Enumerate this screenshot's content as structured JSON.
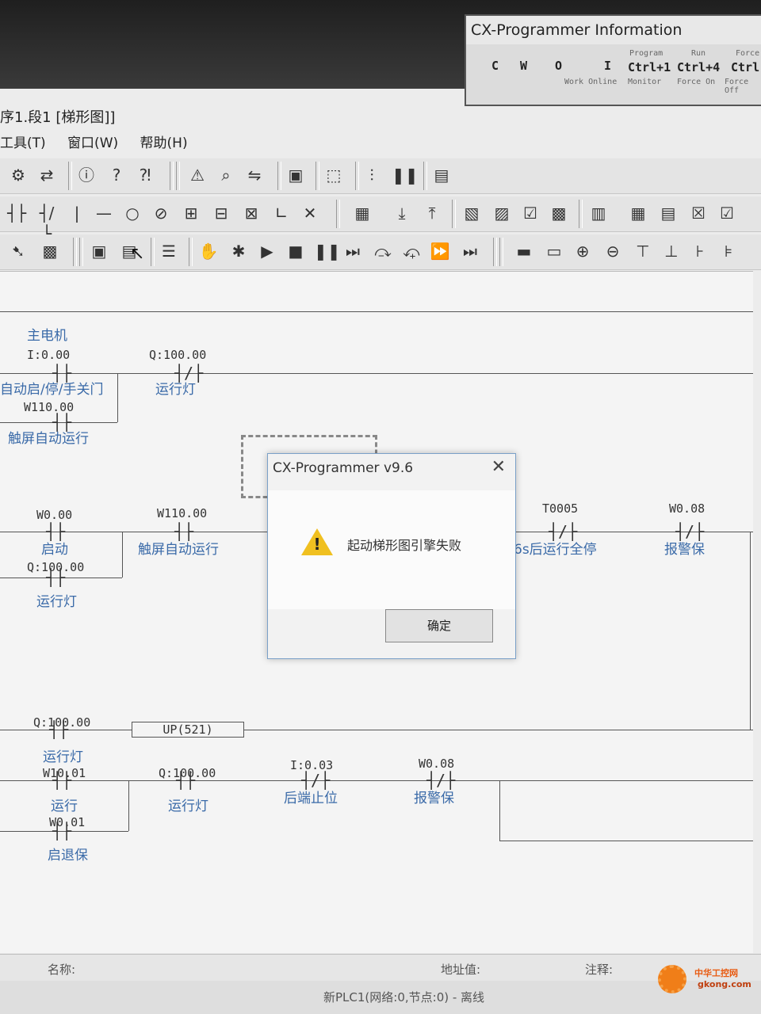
{
  "window": {
    "title": "序1.段1 [梯形图]]"
  },
  "menu": [
    "工具(T)",
    "窗口(W)",
    "帮助(H)"
  ],
  "info_panel": {
    "title": "CX-Programmer Information",
    "cells": [
      "C",
      "W",
      "O",
      "I",
      "Program",
      "Run",
      "Force",
      "Ctrl+1",
      "Ctrl+4",
      "Ctrl",
      "Work Online",
      "Monitor",
      "Force On",
      "Force Off"
    ]
  },
  "ladder": {
    "rung0_comment": "主电机",
    "rung1": {
      "contact1_addr": "I:0.00",
      "contact1_comment": "自动启/停/手关门",
      "contact2_addr": "Q:100.00",
      "contact2_comment": "运行灯",
      "branch_addr": "W110.00",
      "branch_comment": "触屏自动运行"
    },
    "rung2": {
      "contact1_addr": "W0.00",
      "contact1_comment": "启动",
      "contact2_addr": "W110.00",
      "contact2_comment": "触屏自动运行",
      "branch_addr": "Q:100.00",
      "branch_comment": "运行灯",
      "contact3_addr": "T0005",
      "contact3_comment": "6s后运行全停",
      "contact4_addr": "W0.08",
      "contact4_comment": "报警保"
    },
    "rung3": {
      "contact1_addr": "Q:100.00",
      "contact1_comment": "运行灯",
      "instr": "UP(521)"
    },
    "rung4": {
      "contact1_addr": "W10.01",
      "contact1_comment": "运行",
      "contact2_addr": "Q:100.00",
      "contact2_comment": "运行灯",
      "contact3_addr": "I:0.03",
      "contact3_comment": "后端止位",
      "contact4_addr": "W0.08",
      "contact4_comment": "报警保",
      "branch_addr": "W0.01",
      "branch_comment": "启退保"
    }
  },
  "dialog": {
    "title": "CX-Programmer v9.6",
    "message": "起动梯形图引擎失败",
    "ok_label": "确定",
    "close_glyph": "✕"
  },
  "status": {
    "name_label": "名称:",
    "address_label": "地址值:",
    "comment_label": "注释:",
    "plc_status": "新PLC1(网络:0,节点:0) - 离线"
  },
  "watermark": {
    "text1": "中华工控网",
    "text2": "gkong.com"
  }
}
